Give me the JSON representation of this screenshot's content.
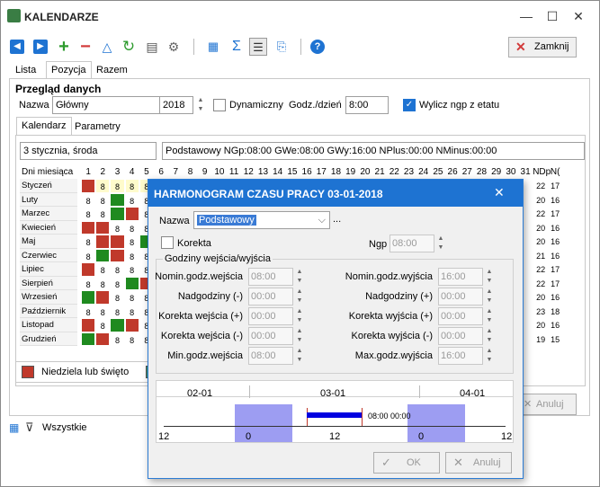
{
  "window": {
    "title": "KALENDARZE",
    "minimize": "—",
    "maximize": "☐",
    "close": "✕"
  },
  "toolbar": {
    "close_label": "Zamknij"
  },
  "main_tabs": [
    "Lista",
    "Pozycja",
    "Razem"
  ],
  "section": {
    "title": "Przegląd danych",
    "name_label": "Nazwa",
    "name_value": "Główny",
    "year": "2018",
    "dynamic_label": "Dynamiczny",
    "hours_label": "Godz./dzień",
    "hours_value": "8:00",
    "wylicz_label": "Wylicz ngp z etatu"
  },
  "inner_tabs": [
    "Kalendarz",
    "Parametry"
  ],
  "info": {
    "date": "3 stycznia, środa",
    "summary": "Podstawowy  NGp:08:00  GWe:08:00  GWy:16:00  NPlus:00:00  NMinus:00:00"
  },
  "grid": {
    "header_label": "Dni miesiąca",
    "days": [
      "1",
      "2",
      "3",
      "4",
      "5",
      "6",
      "7",
      "8",
      "9",
      "10",
      "11",
      "12",
      "13",
      "14",
      "15",
      "16",
      "17",
      "18",
      "19",
      "20",
      "21",
      "22",
      "23",
      "24",
      "25",
      "26",
      "27",
      "28",
      "29",
      "30",
      "31"
    ],
    "extra_headers": [
      "NDp",
      "N("
    ],
    "months": [
      {
        "name": "Styczeń",
        "cells": [
          "red",
          "y8",
          "y8",
          "y8",
          "y8"
        ],
        "r": [
          "22",
          "17"
        ]
      },
      {
        "name": "Luty",
        "cells": [
          "8",
          "8",
          "grn",
          "8",
          "8"
        ],
        "r": [
          "20",
          "16"
        ]
      },
      {
        "name": "Marzec",
        "cells": [
          "8",
          "8",
          "grn",
          "red",
          "8"
        ],
        "r": [
          "22",
          "17"
        ]
      },
      {
        "name": "Kwiecień",
        "cells": [
          "red",
          "red",
          "8",
          "8",
          "8"
        ],
        "r": [
          "20",
          "16"
        ]
      },
      {
        "name": "Maj",
        "cells": [
          "8",
          "red",
          "red",
          "8",
          "grn"
        ],
        "r": [
          "20",
          "16"
        ]
      },
      {
        "name": "Czerwiec",
        "cells": [
          "8",
          "grn",
          "red",
          "8",
          "8"
        ],
        "r": [
          "21",
          "16"
        ]
      },
      {
        "name": "Lipiec",
        "cells": [
          "red",
          "8",
          "8",
          "8",
          "8"
        ],
        "r": [
          "22",
          "17"
        ]
      },
      {
        "name": "Sierpień",
        "cells": [
          "8",
          "8",
          "8",
          "grn",
          "red"
        ],
        "r": [
          "22",
          "17"
        ]
      },
      {
        "name": "Wrzesień",
        "cells": [
          "grn",
          "red",
          "8",
          "8",
          "8"
        ],
        "r": [
          "20",
          "16"
        ]
      },
      {
        "name": "Październik",
        "cells": [
          "8",
          "8",
          "8",
          "8",
          "8"
        ],
        "r": [
          "23",
          "18"
        ]
      },
      {
        "name": "Listopad",
        "cells": [
          "red",
          "8",
          "grn",
          "red",
          "8"
        ],
        "r": [
          "20",
          "16"
        ]
      },
      {
        "name": "Grudzień",
        "cells": [
          "grn",
          "red",
          "8",
          "8",
          "8"
        ],
        "r": [
          "19",
          "15"
        ]
      }
    ]
  },
  "legend": {
    "holiday": "Niedziela lub święto"
  },
  "footer": {
    "filter": "Wszystkie",
    "cancel": "Anuluj"
  },
  "dialog": {
    "title": "HARMONOGRAM CZASU PRACY 03-01-2018",
    "name_label": "Nazwa",
    "name_value": "Podstawowy",
    "more": "...",
    "korekta_label": "Korekta",
    "ngp_label": "Ngp",
    "ngp_value": "08:00",
    "group_title": "Godziny wejścia/wyjścia",
    "left_fields": [
      {
        "label": "Nomin.godz.wejścia",
        "value": "08:00"
      },
      {
        "label": "Nadgodziny (-)",
        "value": "00:00"
      },
      {
        "label": "Korekta wejścia (+)",
        "value": "00:00"
      },
      {
        "label": "Korekta wejścia (-)",
        "value": "00:00"
      },
      {
        "label": "Min.godz.wejścia",
        "value": "08:00"
      }
    ],
    "right_fields": [
      {
        "label": "Nomin.godz.wyjścia",
        "value": "16:00"
      },
      {
        "label": "Nadgodziny (+)",
        "value": "00:00"
      },
      {
        "label": "Korekta wyjścia (+)",
        "value": "00:00"
      },
      {
        "label": "Korekta wyjścia (-)",
        "value": "00:00"
      },
      {
        "label": "Max.godz.wyjścia",
        "value": "16:00"
      }
    ],
    "timeline": {
      "dates": [
        "02-01",
        "03-01",
        "04-01"
      ],
      "ticks": [
        "12",
        "0",
        "12",
        "0",
        "12"
      ],
      "bar_label": "08:00 00:00"
    },
    "ok": "OK",
    "cancel": "Anuluj"
  }
}
